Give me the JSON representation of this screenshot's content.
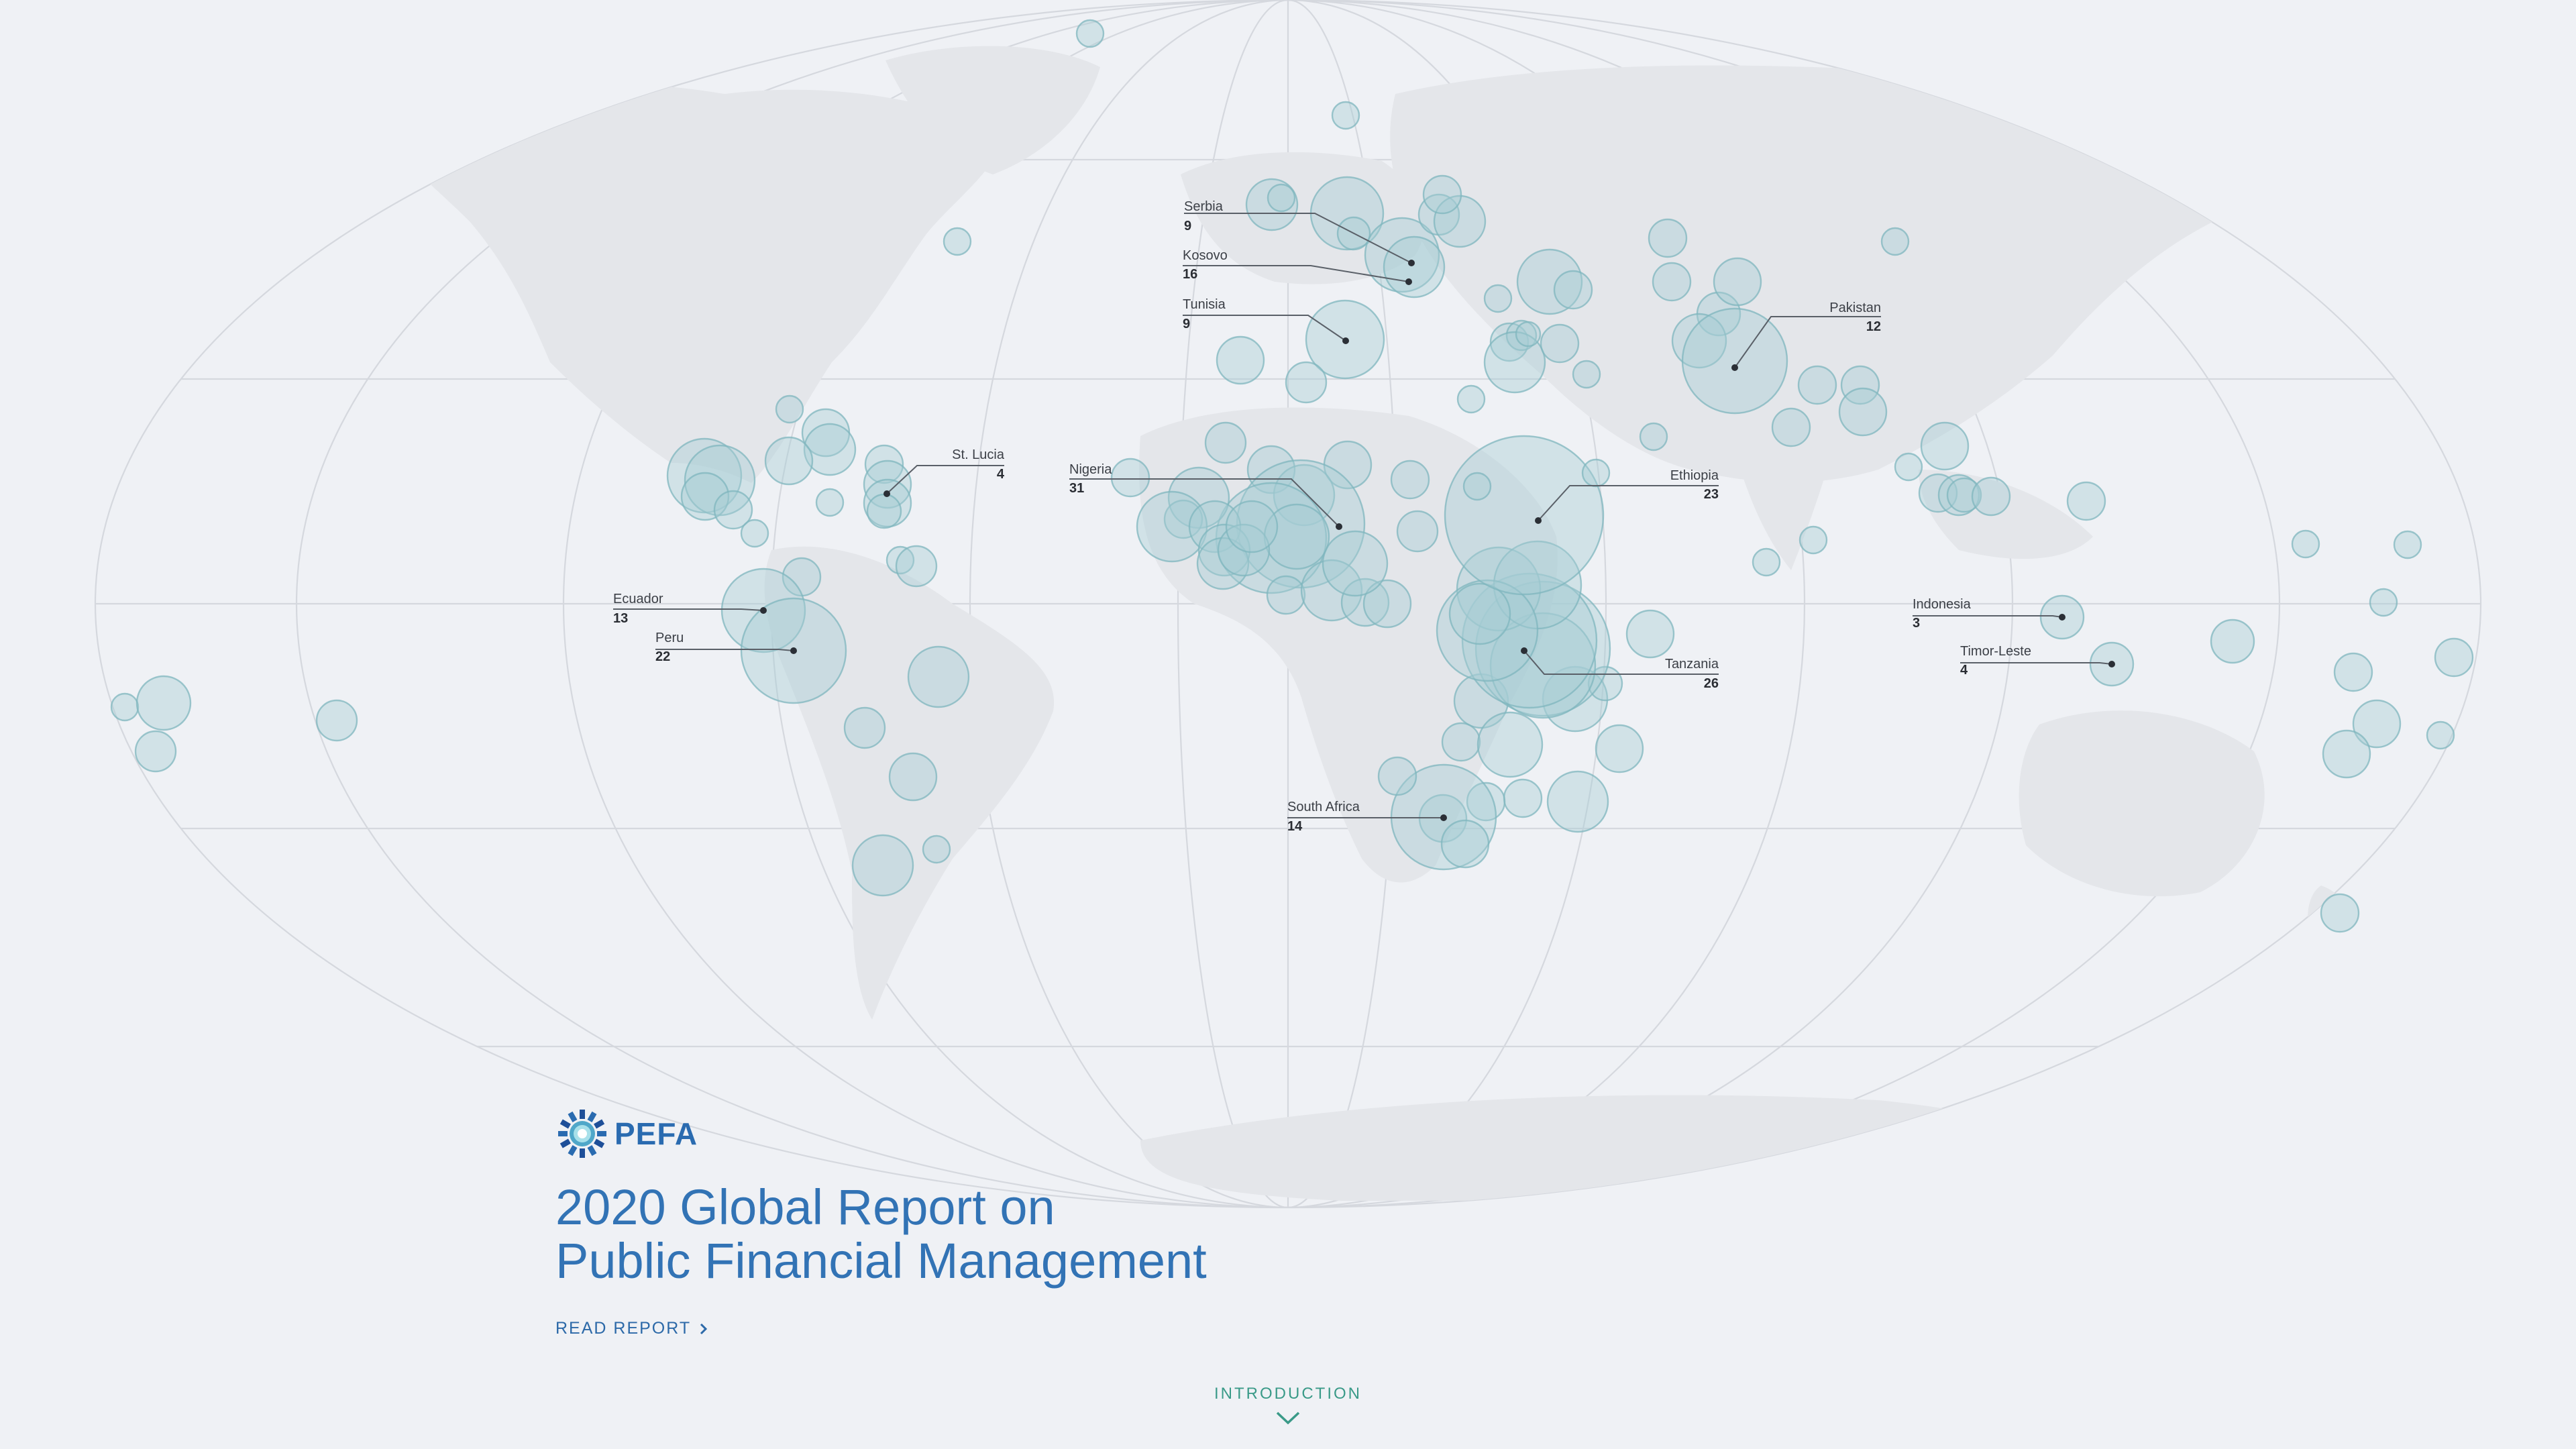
{
  "brand": {
    "name": "PEFA"
  },
  "hero": {
    "title_line1": "2020 Global Report on",
    "title_line2": "Public Financial Management",
    "read_report_label": "READ REPORT"
  },
  "nav": {
    "intro_label": "INTRODUCTION"
  },
  "colors": {
    "background": "#eff1f5",
    "land": "#e4e6ea",
    "bubble_fill": "#a6ccd3",
    "bubble_stroke": "#7fb5be",
    "title": "#3273b5",
    "link": "#2c69a8",
    "intro": "#3a9a88"
  },
  "icons": {
    "logo": "pefa-logo-icon",
    "read_report": "chevron-right-icon",
    "intro": "chevron-down-icon"
  },
  "map": {
    "projection": "robinson-like",
    "labeled_countries": [
      {
        "name": "Serbia",
        "value": "9"
      },
      {
        "name": "Kosovo",
        "value": "16"
      },
      {
        "name": "Tunisia",
        "value": "9"
      },
      {
        "name": "Pakistan",
        "value": "12"
      },
      {
        "name": "St. Lucia",
        "value": "4"
      },
      {
        "name": "Nigeria",
        "value": "31"
      },
      {
        "name": "Ethiopia",
        "value": "23"
      },
      {
        "name": "Ecuador",
        "value": "13"
      },
      {
        "name": "Peru",
        "value": "22"
      },
      {
        "name": "Indonesia",
        "value": "3"
      },
      {
        "name": "Timor-Leste",
        "value": "4"
      },
      {
        "name": "Tanzania",
        "value": "26"
      },
      {
        "name": "South Africa",
        "value": "14"
      }
    ]
  }
}
